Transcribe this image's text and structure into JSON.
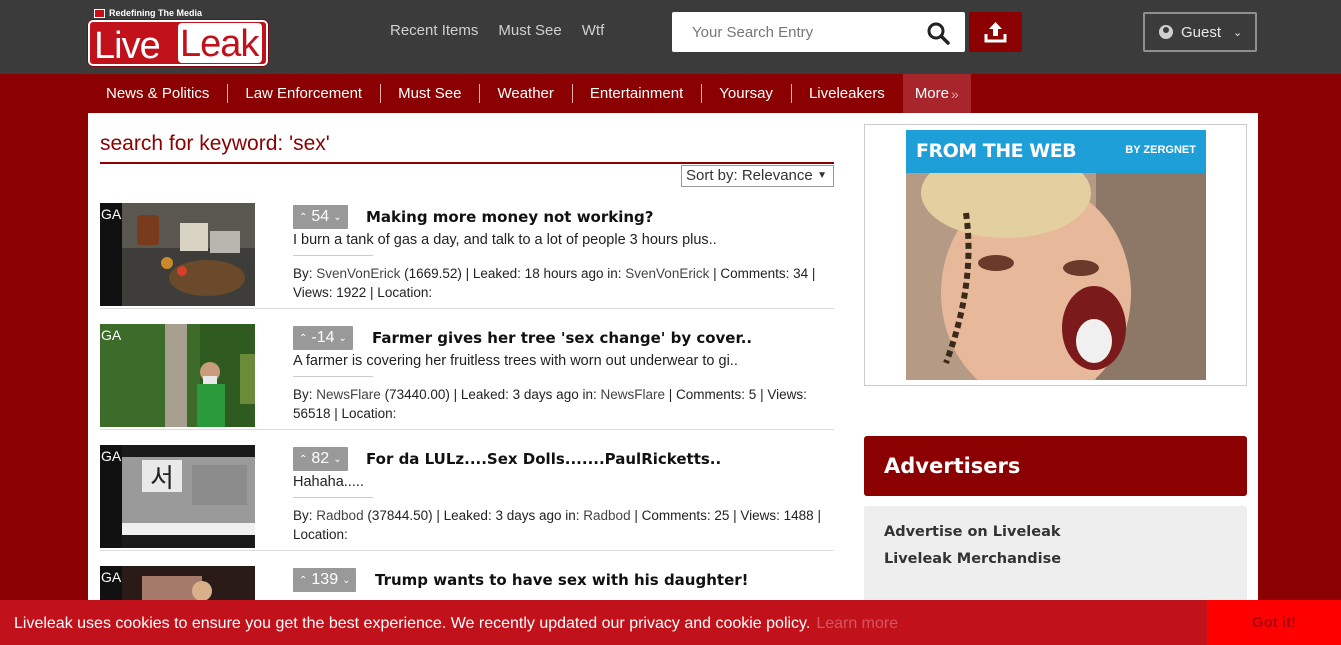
{
  "logo": {
    "tagline": "Redefining The Media",
    "live": "Live",
    "leak": "Leak"
  },
  "toplinks": [
    "Recent Items",
    "Must See",
    "Wtf"
  ],
  "search": {
    "placeholder": "Your Search Entry"
  },
  "user": {
    "label": "Guest"
  },
  "nav": [
    "News & Politics",
    "Law Enforcement",
    "Must See",
    "Weather",
    "Entertainment",
    "Yoursay",
    "Liveleakers",
    "More"
  ],
  "page": {
    "heading": "search for keyword: 'sex'",
    "sort": "Sort by: Relevance"
  },
  "items": [
    {
      "badge": "GA",
      "votes": "54",
      "title": "Making more money not working?",
      "desc": "I burn a tank of gas a day, and talk to a lot of people 3 hours plus..",
      "by_prefix": "By:",
      "author": "SvenVonErick",
      "author_points": "(1669.52) | Leaked: 18 hours ago in:",
      "channel": "SvenVonErick",
      "stats": "| Comments: 34 | Views: 1922 | Location:"
    },
    {
      "badge": "GA",
      "votes": "-14",
      "title": "Farmer gives her tree 'sex change' by cover..",
      "desc": "A farmer is covering her fruitless trees with worn out underwear to gi..",
      "by_prefix": "By:",
      "author": "NewsFlare",
      "author_points": "(73440.00) | Leaked: 3 days ago in:",
      "channel": "NewsFlare",
      "stats": "| Comments: 5 | Views: 56518 | Location:"
    },
    {
      "badge": "GA",
      "votes": "82",
      "title": "For da LULz....Sex Dolls.......PaulRicketts..",
      "desc": "Hahaha.....",
      "by_prefix": "By:",
      "author": "Radbod",
      "author_points": "(37844.50) | Leaked: 3 days ago in:",
      "channel": "Radbod",
      "stats": "| Comments: 25 | Views: 1488 | Location:"
    },
    {
      "badge": "GA",
      "votes": "139",
      "title": "Trump wants to have sex with his daughter!",
      "desc": "",
      "by_prefix": "",
      "author": "",
      "author_points": "",
      "channel": "",
      "stats": ""
    }
  ],
  "ad": {
    "header": "FROM THE WEB",
    "by": "BY ZERGNET"
  },
  "advertisers": {
    "title": "Advertisers",
    "links": [
      "Advertise on Liveleak",
      "Liveleak Merchandise"
    ]
  },
  "cookie": {
    "message": "Liveleak uses cookies to ensure you get the best experience. We recently updated our privacy and cookie policy.",
    "learn": "Learn more",
    "button": "Got it!"
  },
  "colors": {
    "brand_red": "#8b0000",
    "topbar": "#3b3b3b",
    "cookie_red": "#c1121c",
    "ad_blue": "#1e9fd8"
  }
}
